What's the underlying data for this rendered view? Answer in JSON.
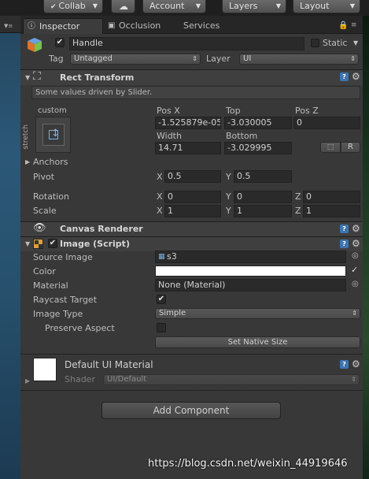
{
  "toolbar": {
    "collab": "Collab",
    "account": "Account",
    "layers": "Layers",
    "layout": "Layout"
  },
  "tabs": {
    "inspector": "Inspector",
    "occlusion": "Occlusion",
    "services": "Services"
  },
  "object": {
    "name": "Handle",
    "static_label": "Static",
    "tag_label": "Tag",
    "tag_value": "Untagged",
    "layer_label": "Layer",
    "layer_value": "UI"
  },
  "rect_transform": {
    "title": "Rect Transform",
    "note": "Some values driven by Slider.",
    "anchor_preset_label": "custom",
    "anchor_side_label": "stretch",
    "pos_x_label": "Pos X",
    "pos_x": "-1.525879e-05",
    "top_label": "Top",
    "top": "-3.030005",
    "pos_z_label": "Pos Z",
    "pos_z": "0",
    "width_label": "Width",
    "width": "14.71",
    "bottom_label": "Bottom",
    "bottom": "-3.029995",
    "r_button": "R",
    "anchors_label": "Anchors",
    "pivot_label": "Pivot",
    "pivot_x": "0.5",
    "pivot_y": "0.5",
    "rotation_label": "Rotation",
    "rotation_x": "0",
    "rotation_y": "0",
    "rotation_z": "0",
    "scale_label": "Scale",
    "scale_x": "1",
    "scale_y": "1",
    "scale_z": "1",
    "axis_x": "X",
    "axis_y": "Y",
    "axis_z": "Z"
  },
  "canvas_renderer": {
    "title": "Canvas Renderer"
  },
  "image": {
    "title": "Image (Script)",
    "source_image_label": "Source Image",
    "source_image": "s3",
    "color_label": "Color",
    "color_value": "#ffffff",
    "material_label": "Material",
    "material": "None (Material)",
    "raycast_label": "Raycast Target",
    "raycast_checked": true,
    "image_type_label": "Image Type",
    "image_type": "Simple",
    "preserve_aspect_label": "Preserve Aspect",
    "preserve_aspect_checked": false,
    "set_native_size": "Set Native Size"
  },
  "material_preview": {
    "title": "Default UI Material",
    "shader_label": "Shader",
    "shader_value": "UI/Default"
  },
  "add_component": "Add Component",
  "watermark": "https://blog.csdn.net/weixin_44919646",
  "colors": {
    "panel_bg": "#383838",
    "accent_blue": "#3d74b0"
  }
}
